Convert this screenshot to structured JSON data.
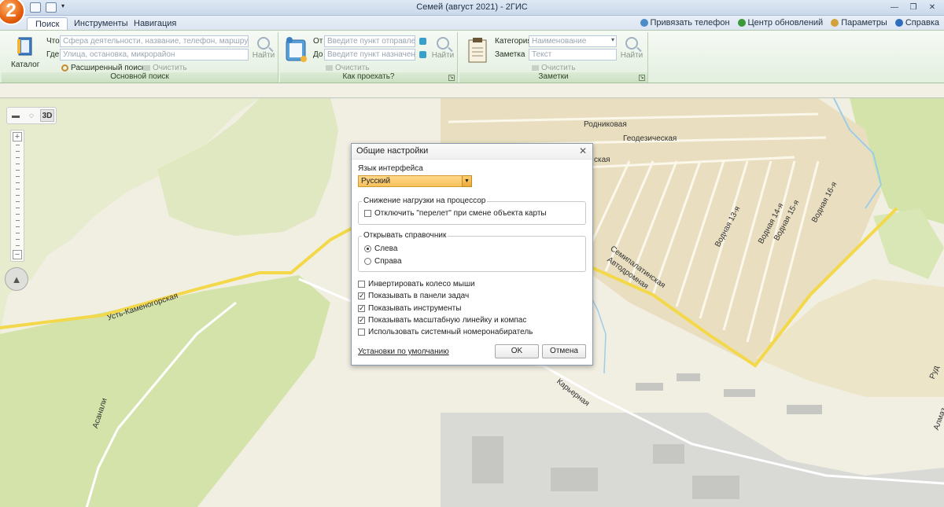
{
  "window": {
    "title": "Семей (август 2021) - 2ГИС",
    "logo_text": "2"
  },
  "tabs": [
    {
      "label": "Поиск",
      "active": true
    },
    {
      "label": "Инструменты",
      "active": false
    },
    {
      "label": "Навигация",
      "active": false
    }
  ],
  "toplinks": {
    "bind_phone": "Привязать телефон",
    "update_center": "Центр обновлений",
    "params": "Параметры",
    "help": "Справка"
  },
  "ribbon": {
    "main_search": {
      "group_label": "Основной поиск",
      "catalog_label": "Каталог",
      "what_label": "Что",
      "what_placeholder": "Сфера деятельности, название, телефон, маршрут",
      "where_label": "Где",
      "where_placeholder": "Улица, остановка, микрорайон",
      "advanced_label": "Расширенный поиск",
      "clear_label": "Очистить",
      "find_label": "Найти"
    },
    "route": {
      "group_label": "Как проехать?",
      "from_label": "От",
      "from_placeholder": "Введите пункт отправления",
      "to_label": "До",
      "to_placeholder": "Введите пункт назначения",
      "clear_label": "Очистить",
      "find_label": "Найти"
    },
    "notes": {
      "group_label": "Заметки",
      "category_label": "Категория",
      "category_placeholder": "Наименование",
      "note_label": "Заметка",
      "note_placeholder": "Текст",
      "clear_label": "Очистить",
      "find_label": "Найти"
    }
  },
  "map": {
    "view_3d": "3D",
    "streets": {
      "rodnikovaya": "Родниковая",
      "geodezicheskaya": "Геодезическая",
      "semipalatinskaya": "Семипалатинская",
      "avtodoromnaya": "Автодромная",
      "vodnaya13": "Водная 13-я",
      "vodnaya14": "Водная 14-я",
      "vodnaya15": "Водная 15-я",
      "vodnaya16": "Водная 16-я",
      "ust_kamenogorskaya": "Усть-Каменогорская",
      "karyernaya": "Карьерная",
      "asanali": "Асанали",
      "partial_skaya": "ская",
      "partial_rud": "Руд",
      "partial_almaz": "Алмаз"
    },
    "colors": {
      "main_road": "#f3d84a",
      "green": "#d3e3a9",
      "residential": "#e9dfc0",
      "water": "#9ecde8",
      "industrial": "#d7d7d4"
    }
  },
  "dialog": {
    "title": "Общие настройки",
    "lang_label": "Язык интерфейса",
    "lang_value": "Русский",
    "cpu_legend": "Снижение нагрузки на процессор",
    "cpu_option": "Отключить \"перелет\" при смене объекта карты",
    "cpu_option_checked": false,
    "open_legend": "Открывать справочник",
    "open_left": "Слева",
    "open_right": "Справа",
    "open_selected": "left",
    "opt_invert": "Инвертировать колесо мыши",
    "opt_invert_checked": false,
    "opt_taskbar": "Показывать в панели задач",
    "opt_taskbar_checked": true,
    "opt_tools": "Показывать инструменты",
    "opt_tools_checked": true,
    "opt_scale": "Показывать масштабную линейку и компас",
    "opt_scale_checked": true,
    "opt_dialer": "Использовать системный номеронабиратель",
    "opt_dialer_checked": false,
    "defaults_link": "Установки по умолчанию",
    "ok": "OK",
    "cancel": "Отмена"
  }
}
